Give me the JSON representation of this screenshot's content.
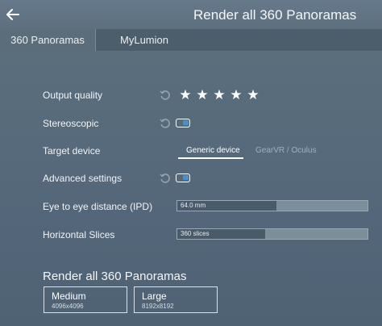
{
  "window": {
    "title": "Render all 360 Panoramas"
  },
  "tabs": [
    {
      "label": "360 Panoramas",
      "active": true
    },
    {
      "label": "MyLumion",
      "active": false
    }
  ],
  "settings": {
    "output_quality": {
      "label": "Output quality",
      "stars_filled": 5,
      "stars_total": 5
    },
    "stereoscopic": {
      "label": "Stereoscopic",
      "enabled": true
    },
    "target_device": {
      "label": "Target device",
      "options": [
        "Generic device",
        "GearVR / Oculus"
      ],
      "selected": "Generic device"
    },
    "advanced": {
      "label": "Advanced settings",
      "enabled": true
    },
    "ipd": {
      "label": "Eye to eye distance (IPD)",
      "value_text": "64.0 mm",
      "fill_fraction": 0.52
    },
    "slices": {
      "label": "Horizontal Slices",
      "value_text": "360 slices",
      "fill_fraction": 0.46
    }
  },
  "render": {
    "title": "Render all 360 Panoramas",
    "buttons": [
      {
        "name": "Medium",
        "resolution": "4096x4096"
      },
      {
        "name": "Large",
        "resolution": "8192x8192"
      }
    ]
  },
  "colors": {
    "background": "#5b6d7b",
    "accent": "#4b8fd1"
  }
}
